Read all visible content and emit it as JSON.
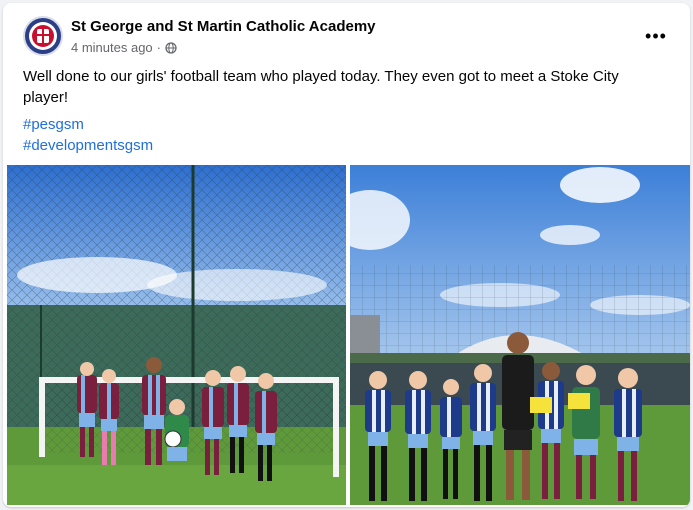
{
  "post": {
    "author": "St George and St Martin Catholic Academy",
    "time": "4 minutes ago",
    "separator": "·",
    "audience_icon": "globe-icon",
    "more_icon": "more-dots-icon",
    "more_label": "•••",
    "text": "Well done to our girls' football team who played today. They even got to meet a Stoke City player!",
    "hashtags": [
      "#pesgsm",
      "#developmentsgsm"
    ]
  },
  "colors": {
    "link": "#216fdb",
    "secondary_text": "#65676b",
    "primary_text": "#050505",
    "kit_claret": "#7a1f3d",
    "kit_sky_blue": "#7fb2e6"
  },
  "photos": [
    {
      "name": "team-photo-left",
      "description_icon": "photo-image"
    },
    {
      "name": "team-photo-right",
      "description_icon": "photo-image"
    }
  ]
}
